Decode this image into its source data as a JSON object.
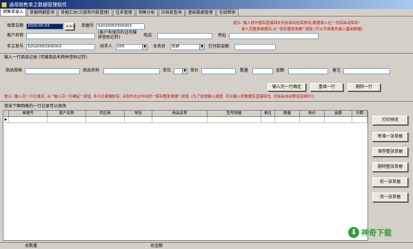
{
  "window": {
    "title": "通用销售单之数据管理软件"
  },
  "tabs": [
    {
      "label": "销售单录入",
      "active": true
    },
    {
      "label": "单据明细查询",
      "active": false
    },
    {
      "label": "单据汇总(欠款和付款管理)",
      "active": false
    },
    {
      "label": "往来管理",
      "active": false
    },
    {
      "label": "销售分析",
      "active": false
    },
    {
      "label": "应收款查询",
      "active": false
    },
    {
      "label": "基础数据管理",
      "active": false
    },
    {
      "label": "在线帮助",
      "active": false
    }
  ],
  "header": {
    "date_label": "填单日期",
    "date_value": "2020-05-03",
    "nav_btn": ">>>",
    "docno_label": "单据号",
    "docno_value": "S2020050300003",
    "customer_label": "客户名称",
    "customer_value": "",
    "customer_hint": "(客户有保存的话可输拼音助记符)",
    "phone_label": "电话",
    "phone_value": "",
    "address_label": "地址",
    "address_value": "",
    "manual_label": "手工单号",
    "manual_value": "S2020050300003",
    "handler_label": "经手人",
    "handler_value": "005",
    "salesman_label": "业务员",
    "salesman_value": "陈静",
    "paid_label": "已付款金额",
    "paid_value": "",
    "tip1": "提示: 输入好内容后直接回车光标自动往后移动,数据录入过一次后自动保存!",
    "tip2": "录入完整体单据后,点 \"保存整张单据\" 按钮 (可以不用事先录入基础数据)"
  },
  "line_entry": {
    "section_title": "输入一行商品记录 (可输商品名称拼音助记符)",
    "spec_label": "商品规格",
    "name_label": "商品名称",
    "unit_label": "单位",
    "price_label": "单价",
    "qty_label": "数量",
    "amount_label": "金额",
    "note_label": "备注",
    "confirm_btn": "输入完一行确定",
    "reset_btn": "重填一行",
    "delete_btn": "删除一行",
    "tip": "提示: 输入完一行记录后, 点 \"输入完一行确定\" 按钮, 多行记录输好后, 点软件右边中间的 \"保存整张单据\" 按钮. (为了加快输入速度, 可以输入好数据后直接回车, 光标会自动移至后续栏!)"
  },
  "grid": {
    "caption": "双击下面网格的一行记录可以修改",
    "columns": [
      "单据号",
      "客户名称",
      "供应商",
      "地址",
      "商品名称",
      "型号规格",
      "单位",
      "数量",
      "单价",
      "金额",
      "日期"
    ]
  },
  "side_buttons": [
    {
      "label": "打印预览"
    },
    {
      "label": "新增一张单据"
    },
    {
      "label": "保存整张单据"
    },
    {
      "label": "删除整张单据"
    },
    {
      "label": "前一张单据"
    },
    {
      "label": "后一张单据"
    }
  ],
  "status": {
    "total_qty_label": "总数量",
    "total_amount_label": "总金额"
  },
  "watermark": {
    "text": "神奇下载"
  }
}
